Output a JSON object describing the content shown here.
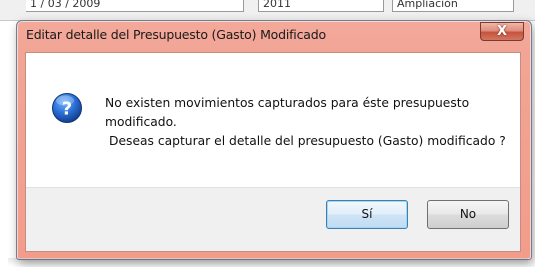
{
  "background": {
    "field1_text": "1 / 03 / 2009",
    "field2_text": "2011",
    "field3_text": "Ampliación"
  },
  "dialog": {
    "title": "Editar detalle del Presupuesto (Gasto) Modificado",
    "close_glyph": "X",
    "icon": "question-icon",
    "message": {
      "line1": "No existen movimientos capturados para éste presupuesto",
      "line2": "modificado.",
      "line3": "Deseas capturar el detalle del presupuesto (Gasto) modificado ?"
    },
    "buttons": {
      "yes_label": "Sí",
      "no_label": "No"
    }
  },
  "colors": {
    "frame_accent": "#f2a596",
    "close_button": "#c5533f",
    "default_button_border": "#3c7fb1",
    "icon_blue": "#1f5fbf"
  }
}
